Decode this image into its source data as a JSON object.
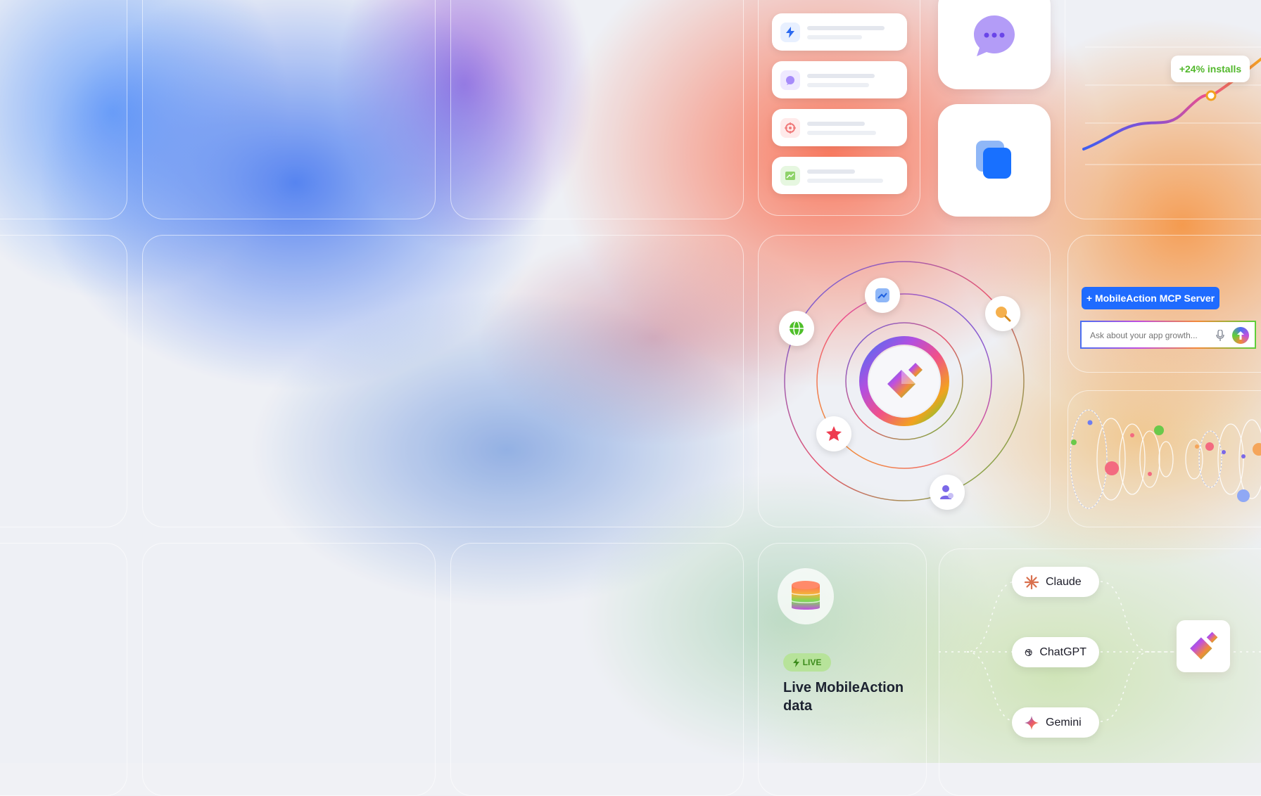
{
  "chart_card": {
    "installs_badge": "+24% installs",
    "accent": "#52b82c"
  },
  "mcp_panel": {
    "server_button_label": "+  MobileAction MCP Server",
    "input_placeholder": "Ask about your app growth...",
    "button_color": "#1f6bff"
  },
  "live_card": {
    "badge_label": "LIVE",
    "title": "Live MobileAction data"
  },
  "llm_list": {
    "items": [
      {
        "label": "Claude",
        "icon": "claude-icon"
      },
      {
        "label": "ChatGPT",
        "icon": "chatgpt-icon"
      },
      {
        "label": "Gemini",
        "icon": "gemini-icon"
      }
    ]
  },
  "icons": {
    "chat": "chat-bubble-icon",
    "layers": "layers-icon",
    "bolt": "bolt-icon",
    "message": "message-icon",
    "target": "target-icon",
    "trend": "trend-icon",
    "globe": "globe-icon",
    "search": "search-icon",
    "star": "star-icon",
    "users": "users-icon",
    "database": "database-icon",
    "mic": "microphone-icon",
    "send": "send-icon",
    "logo": "mobileaction-logo-icon"
  }
}
